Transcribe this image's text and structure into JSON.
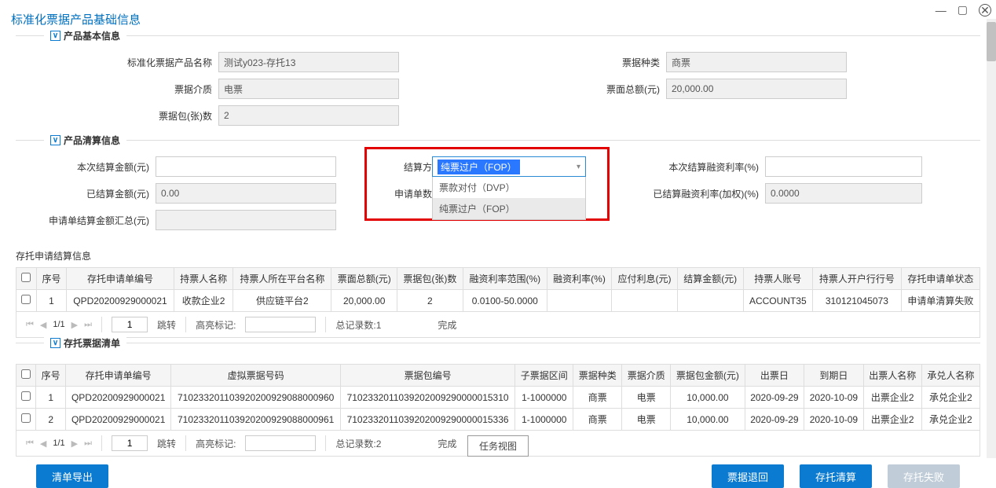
{
  "window": {
    "minimize": "—",
    "maximize": "▢",
    "close": "✕"
  },
  "page_title": "标准化票据产品基础信息",
  "basic": {
    "legend": "产品基本信息",
    "product_name_label": "标准化票据产品名称",
    "product_name": "测试y023-存托13",
    "bill_type_label": "票据种类",
    "bill_type": "商票",
    "medium_label": "票据介质",
    "medium": "电票",
    "face_total_label": "票面总额(元)",
    "face_total": "20,000.00",
    "pack_count_label": "票据包(张)数",
    "pack_count": "2"
  },
  "clearing": {
    "legend": "产品清算信息",
    "amt_label": "本次结算金额(元)",
    "amt": "",
    "method_label": "结算方式",
    "method_selected": "纯票过户（FOP）",
    "options": [
      "票款对付（DVP）",
      "纯票过户（FOP）"
    ],
    "rate_label": "本次结算融资利率(%)",
    "rate": "",
    "settled_label": "已结算金额(元)",
    "settled": "0.00",
    "apply_cnt_label": "申请单数量",
    "settled_rate_label": "已结算融资利率(加权)(%)",
    "settled_rate": "0.0000",
    "sum_label": "申请单结算金额汇总(元)",
    "sum": ""
  },
  "settle_info": {
    "title": "存托申请结算信息",
    "headers": [
      "",
      "序号",
      "存托申请单编号",
      "持票人名称",
      "持票人所在平台名称",
      "票面总额(元)",
      "票据包(张)数",
      "融资利率范围(%)",
      "融资利率(%)",
      "应付利息(元)",
      "结算金额(元)",
      "持票人账号",
      "持票人开户行行号",
      "存托申请单状态"
    ],
    "row": {
      "idx": "1",
      "no": "QPD20200929000021",
      "holder": "收款企业2",
      "platform": "供应链平台2",
      "face": "20,000.00",
      "cnt": "2",
      "range": "0.0100-50.0000",
      "rate": "",
      "interest": "",
      "amt": "",
      "acct": "ACCOUNT35",
      "bank": "310121045073",
      "status": "申请单清算失败"
    },
    "pager": {
      "page": "1/1",
      "goto": "1",
      "jump": "跳转",
      "hl": "高亮标记:",
      "total": "总记录数:1",
      "done": "完成"
    }
  },
  "bill_list": {
    "legend": "存托票据清单",
    "headers": [
      "",
      "序号",
      "存托申请单编号",
      "虚拟票据号码",
      "票据包编号",
      "子票据区间",
      "票据种类",
      "票据介质",
      "票据包金额(元)",
      "出票日",
      "到期日",
      "出票人名称",
      "承兑人名称"
    ],
    "rows": [
      {
        "idx": "1",
        "no": "QPD20200929000021",
        "vno": "710233201103920200929088000960",
        "pno": "7102332011039202009290000015310",
        "range": "1-1000000",
        "type": "商票",
        "medium": "电票",
        "amt": "10,000.00",
        "issue": "2020-09-29",
        "due": "2020-10-09",
        "drawer": "出票企业2",
        "acceptor": "承兑企业2"
      },
      {
        "idx": "2",
        "no": "QPD20200929000021",
        "vno": "710233201103920200929088000961",
        "pno": "7102332011039202009290000015336",
        "range": "1-1000000",
        "type": "商票",
        "medium": "电票",
        "amt": "10,000.00",
        "issue": "2020-09-29",
        "due": "2020-10-09",
        "drawer": "出票企业2",
        "acceptor": "承兑企业2"
      }
    ],
    "pager": {
      "page": "1/1",
      "goto": "1",
      "jump": "跳转",
      "hl": "高亮标记:",
      "total": "总记录数:2",
      "done": "完成"
    }
  },
  "buttons": {
    "export": "清单导出",
    "back": "票据退回",
    "settle": "存托清算",
    "fail": "存托失败"
  },
  "task_view": "任务视图"
}
